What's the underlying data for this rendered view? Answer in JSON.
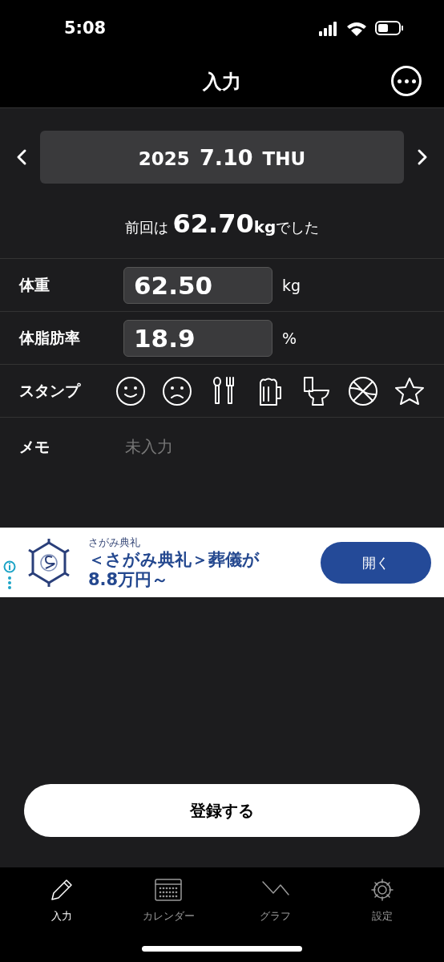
{
  "status_bar": {
    "time": "5:08"
  },
  "nav": {
    "title": "入力"
  },
  "date": {
    "year": "2025",
    "day": "7.10",
    "weekday": "THU"
  },
  "previous": {
    "prefix": "前回は",
    "value": "62.70",
    "unit": "kg",
    "suffix": "でした"
  },
  "fields": [
    {
      "label": "体重",
      "value": "62.50",
      "unit": "kg"
    },
    {
      "label": "体脂肪率",
      "value": "18.9",
      "unit": "%"
    }
  ],
  "stamps": {
    "label": "スタンプ",
    "items": [
      {
        "kind": "smile"
      },
      {
        "kind": "frown"
      },
      {
        "kind": "cutlery"
      },
      {
        "kind": "beer"
      },
      {
        "kind": "toilet"
      },
      {
        "kind": "ball"
      },
      {
        "kind": "star"
      }
    ]
  },
  "memo": {
    "label": "メモ",
    "placeholder": "未入力"
  },
  "ad": {
    "advertiser": "さがみ典礼",
    "headline": "＜さがみ典礼＞葬儀が8.8万円～",
    "button": "開く"
  },
  "register_button": "登録する",
  "tabs": [
    {
      "kind": "pencil",
      "label": "入力",
      "selected": true
    },
    {
      "kind": "calendar",
      "label": "カレンダー",
      "selected": false
    },
    {
      "kind": "graph",
      "label": "グラフ",
      "selected": false
    },
    {
      "kind": "gear",
      "label": "設定",
      "selected": false
    }
  ]
}
